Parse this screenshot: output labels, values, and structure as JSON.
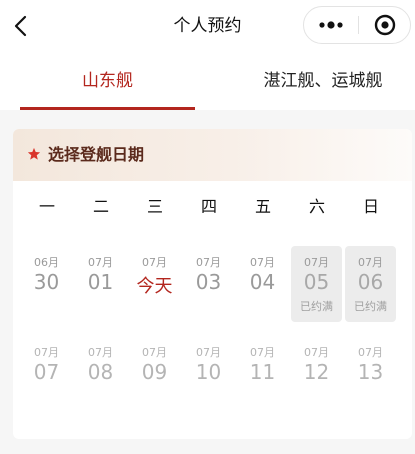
{
  "header": {
    "title": "个人预约"
  },
  "tabs": [
    {
      "label": "山东舰",
      "active": true
    },
    {
      "label": "湛江舰、运城舰",
      "active": false
    }
  ],
  "card": {
    "title": "选择登舰日期",
    "weekdays": [
      "一",
      "二",
      "三",
      "四",
      "五",
      "六",
      "日"
    ]
  },
  "calendar": {
    "week1": [
      {
        "month": "06月",
        "day": "30",
        "status": ""
      },
      {
        "month": "07月",
        "day": "01",
        "status": ""
      },
      {
        "month": "07月",
        "day": "今天",
        "status": ""
      },
      {
        "month": "07月",
        "day": "03",
        "status": ""
      },
      {
        "month": "07月",
        "day": "04",
        "status": ""
      },
      {
        "month": "07月",
        "day": "05",
        "status": "已约满"
      },
      {
        "month": "07月",
        "day": "06",
        "status": "已约满"
      }
    ],
    "week2": [
      {
        "month": "07月",
        "day": "07",
        "status": ""
      },
      {
        "month": "07月",
        "day": "08",
        "status": ""
      },
      {
        "month": "07月",
        "day": "09",
        "status": ""
      },
      {
        "month": "07月",
        "day": "10",
        "status": ""
      },
      {
        "month": "07月",
        "day": "11",
        "status": ""
      },
      {
        "month": "07月",
        "day": "12",
        "status": ""
      },
      {
        "month": "07月",
        "day": "13",
        "status": ""
      }
    ]
  },
  "colors": {
    "accent": "#b3261e",
    "title_brown": "#5b2a1c",
    "full_bg": "#ececec"
  }
}
